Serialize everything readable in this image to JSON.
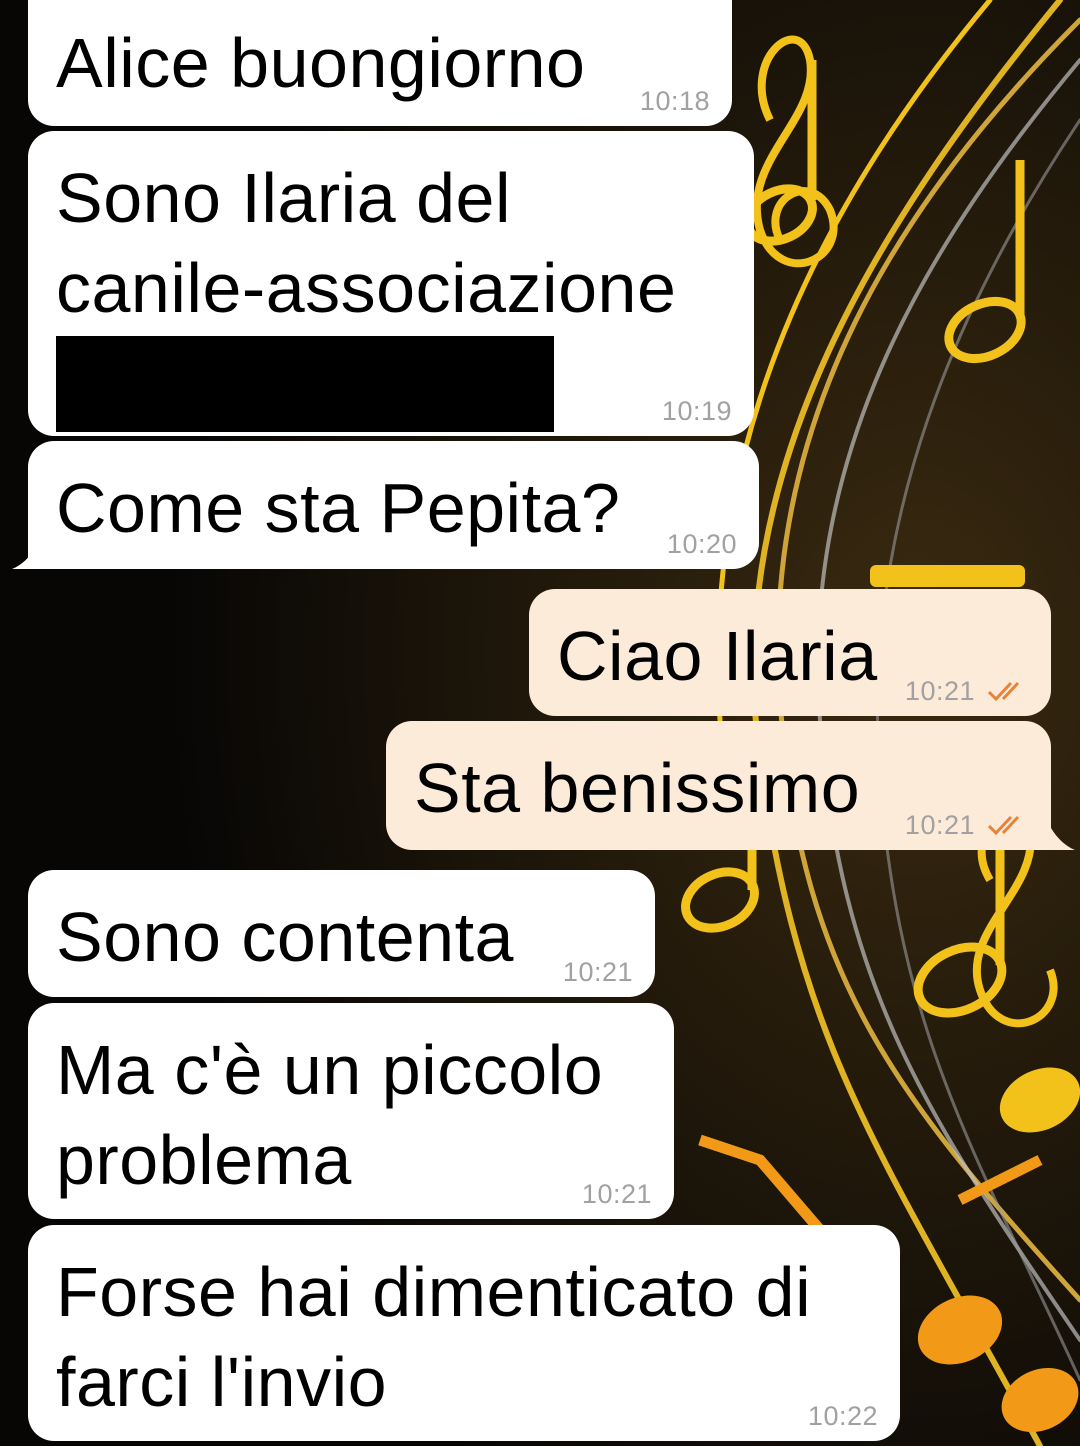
{
  "messages": [
    {
      "direction": "incoming",
      "lines": [
        "Alice buongiorno"
      ],
      "time": "10:18"
    },
    {
      "direction": "incoming",
      "lines": [
        "Sono Ilaria del",
        "canile-associazione"
      ],
      "redacted": true,
      "time": "10:19"
    },
    {
      "direction": "incoming",
      "lines": [
        "Come sta Pepita?"
      ],
      "time": "10:20"
    },
    {
      "direction": "outgoing",
      "lines": [
        "Ciao Ilaria"
      ],
      "time": "10:21",
      "status": "read"
    },
    {
      "direction": "outgoing",
      "lines": [
        "Sta benissimo"
      ],
      "time": "10:21",
      "status": "read"
    },
    {
      "direction": "incoming",
      "lines": [
        "Sono contenta"
      ],
      "time": "10:21"
    },
    {
      "direction": "incoming",
      "lines": [
        "Ma c'è un piccolo",
        "problema"
      ],
      "time": "10:21"
    },
    {
      "direction": "incoming",
      "lines": [
        "Forse hai dimenticato di",
        "farci l'invio"
      ],
      "time": "10:22"
    }
  ],
  "icons": {
    "read_receipt": "double-check-icon",
    "wallpaper": "music-notes-wallpaper"
  },
  "colors": {
    "incoming_bubble": "#ffffff",
    "outgoing_bubble": "#fdebd9",
    "read_ticks": "#e8823a",
    "timestamp": "#a1a1a1",
    "wallpaper_dark": "#0a0806",
    "wallpaper_gold": "#f2c21a"
  }
}
